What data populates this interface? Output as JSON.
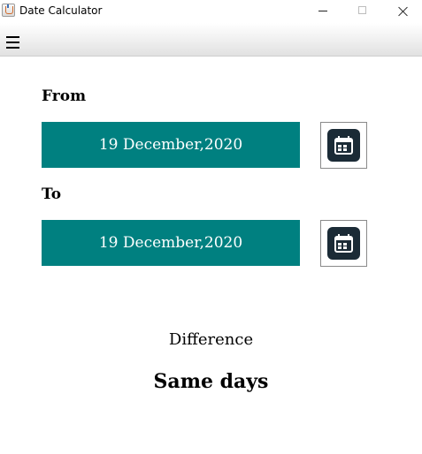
{
  "window": {
    "title": "Date Calculator",
    "icon": "java-cup-icon"
  },
  "menubar": {
    "menu_icon": "hamburger-menu-icon"
  },
  "from": {
    "label": "From",
    "date": "19 December,2020",
    "button_icon": "calendar-icon"
  },
  "to": {
    "label": "To",
    "date": "19 December,2020",
    "button_icon": "calendar-icon"
  },
  "result": {
    "label": "Difference",
    "value": "Same days"
  },
  "colors": {
    "date_field_bg": "#008080",
    "date_field_text": "#ffffff",
    "calendar_icon_bg": "#1b2b36"
  }
}
